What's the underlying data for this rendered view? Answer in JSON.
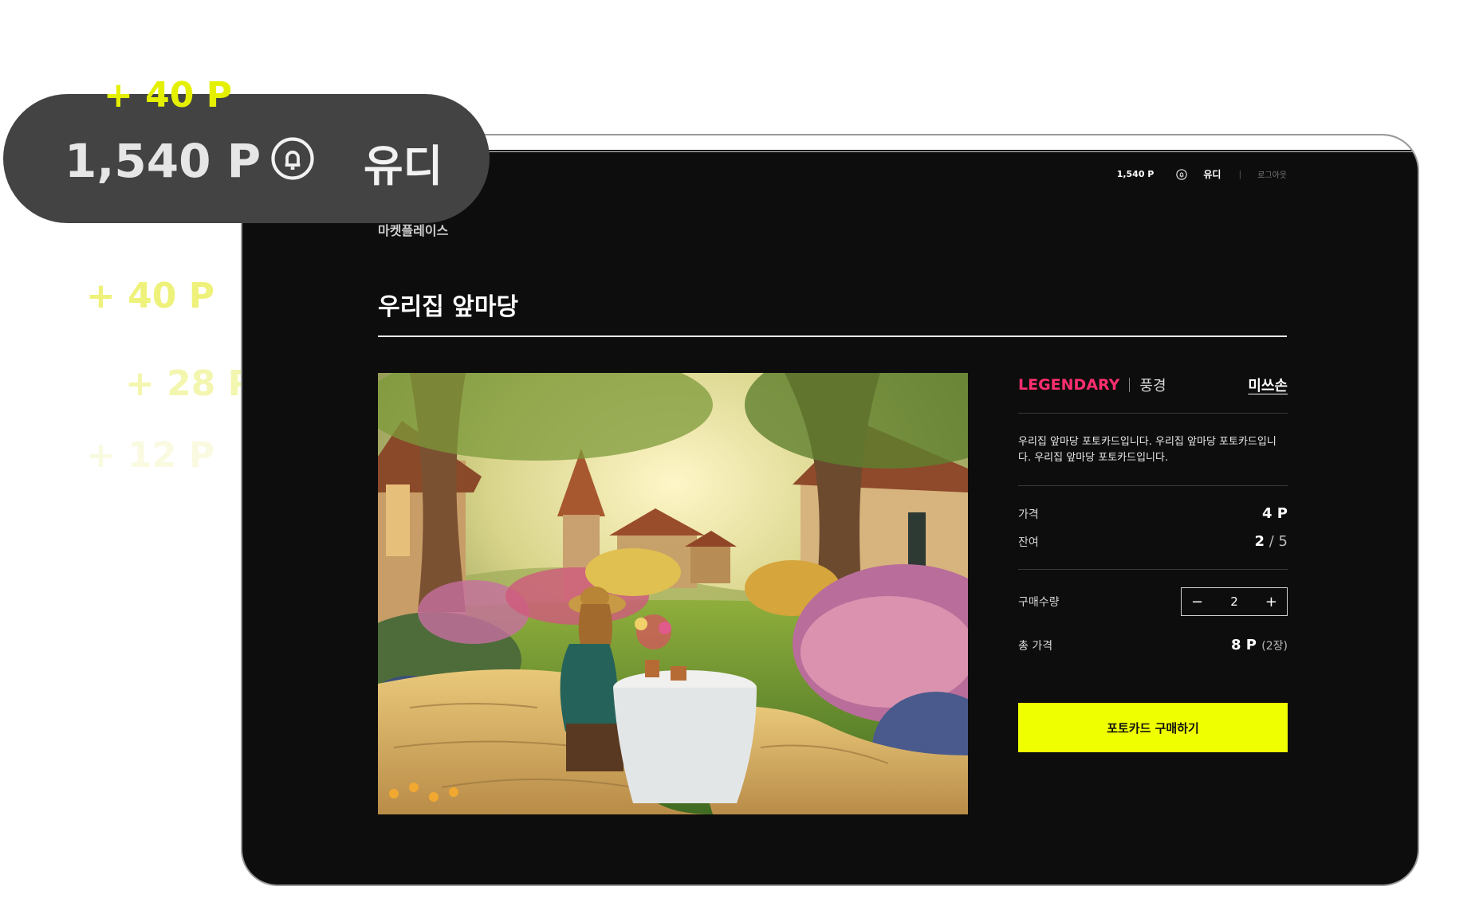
{
  "floating_points": [
    "+ 40 P",
    "+ 40 P",
    "+ 28 P",
    "+ 12 P"
  ],
  "pill": {
    "points": "1,540 P",
    "bell_icon": "bell-icon",
    "user": "유디"
  },
  "nav": {
    "points": "1,540 P",
    "bell_icon": "bell-icon",
    "user": "유디",
    "separator": "|",
    "logout": "로그아웃"
  },
  "breadcrumb": "마켓플레이스",
  "title": "우리집 앞마당",
  "artwork": {
    "alt": "우리집 앞마당"
  },
  "detail": {
    "rarity": "LEGENDARY",
    "rarity_color": "#ff2e6e",
    "category": "풍경",
    "mission": "미쓰손",
    "description": "우리집 앞마당 포토카드입니다. 우리집 앞마당 포토카드입니다. 우리집 앞마당 포토카드입니다.",
    "price_label": "가격",
    "price_value": "4 P",
    "remaining_label": "잔여",
    "remaining_current": "2",
    "remaining_sep": " / ",
    "remaining_total": "5",
    "qty_label": "구매수량",
    "qty_minus": "−",
    "qty_value": "2",
    "qty_plus": "+",
    "total_label": "총 가격",
    "total_value": "8 P",
    "total_count": "(2장)",
    "buy_label": "포토카드 구매하기",
    "buy_color": "#f0ff00"
  }
}
